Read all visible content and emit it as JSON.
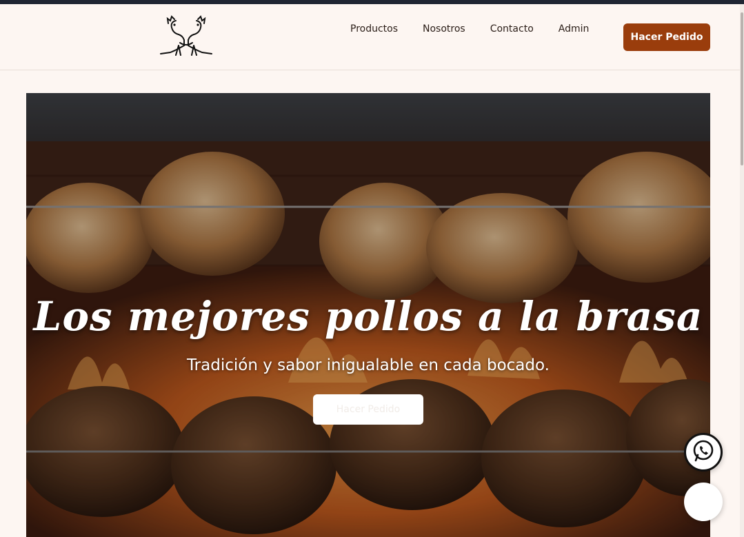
{
  "header": {
    "logo_name": "roosters-logo",
    "nav": [
      {
        "label": "Productos"
      },
      {
        "label": "Nosotros"
      },
      {
        "label": "Contacto"
      },
      {
        "label": "Admin"
      }
    ],
    "cta_label": "Hacer Pedido"
  },
  "hero": {
    "title": "Los mejores pollos a la brasa",
    "subtitle": "Tradición y sabor inigualable en cada bocado.",
    "button_label": "Hacer Pedido",
    "image": "rotisserie-chickens-over-fire"
  },
  "floating": {
    "whatsapp_icon": "whatsapp-icon",
    "chat_icon": "chat-icon"
  },
  "colors": {
    "accent": "#9a3d0c",
    "background": "#fdf6f2",
    "text": "#2a1d17"
  }
}
